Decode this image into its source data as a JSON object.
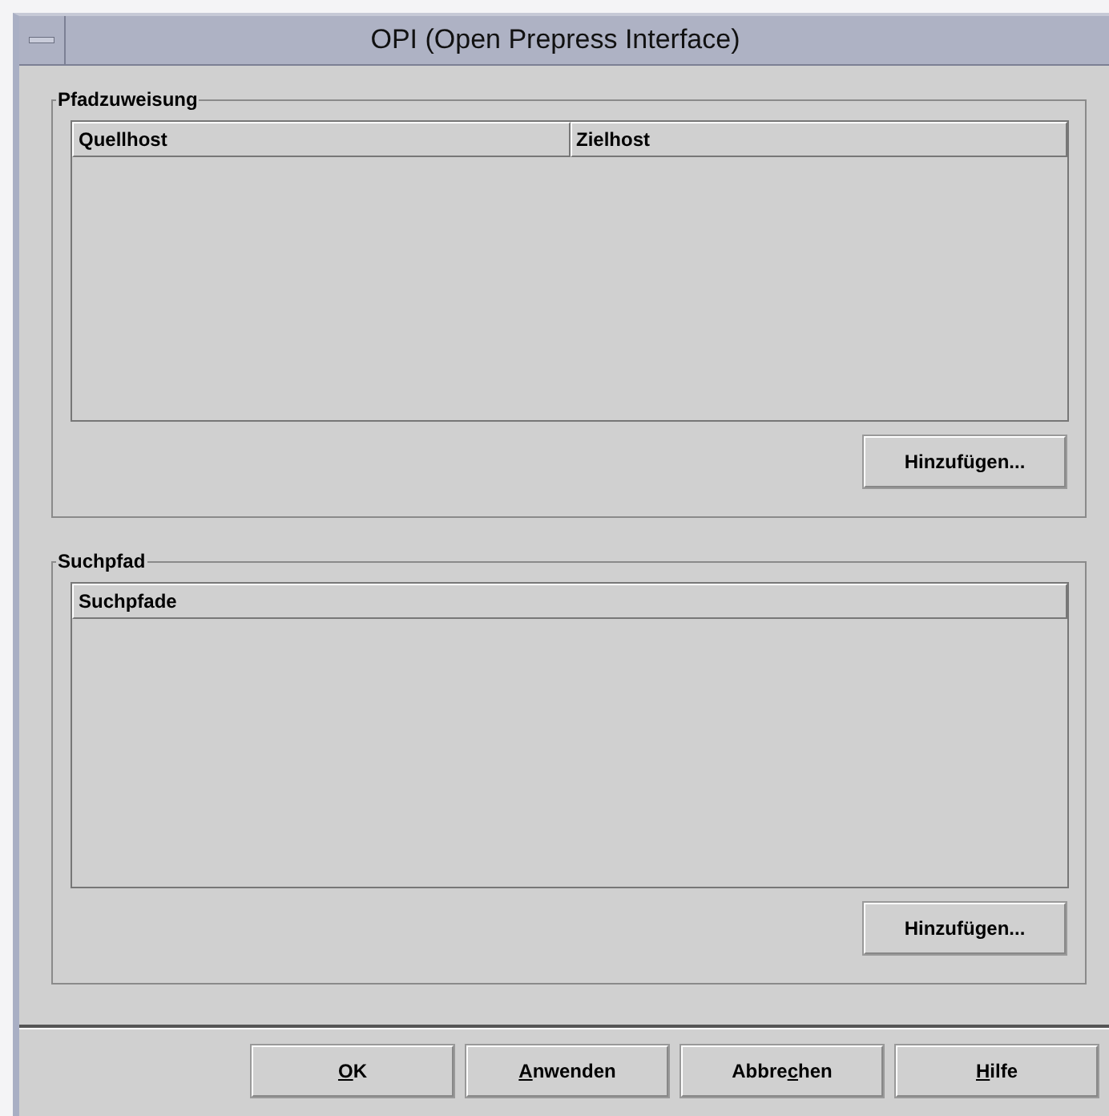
{
  "window": {
    "title": "OPI (Open Prepress Interface)"
  },
  "groups": [
    {
      "title": "Pfadzuweisung",
      "columns": [
        "Quellhost",
        "Zielhost"
      ],
      "button": "Hinzufügen..."
    },
    {
      "title": "Suchpfad",
      "columns": [
        "Suchpfade"
      ],
      "button": "Hinzufügen..."
    }
  ],
  "buttons": [
    {
      "mnemonic": "O",
      "after": "K"
    },
    {
      "mnemonic": "A",
      "after": "nwenden"
    },
    {
      "before": "Abbre",
      "mnemonic": "c",
      "after": "hen"
    },
    {
      "mnemonic": "H",
      "after": "ilfe"
    }
  ]
}
